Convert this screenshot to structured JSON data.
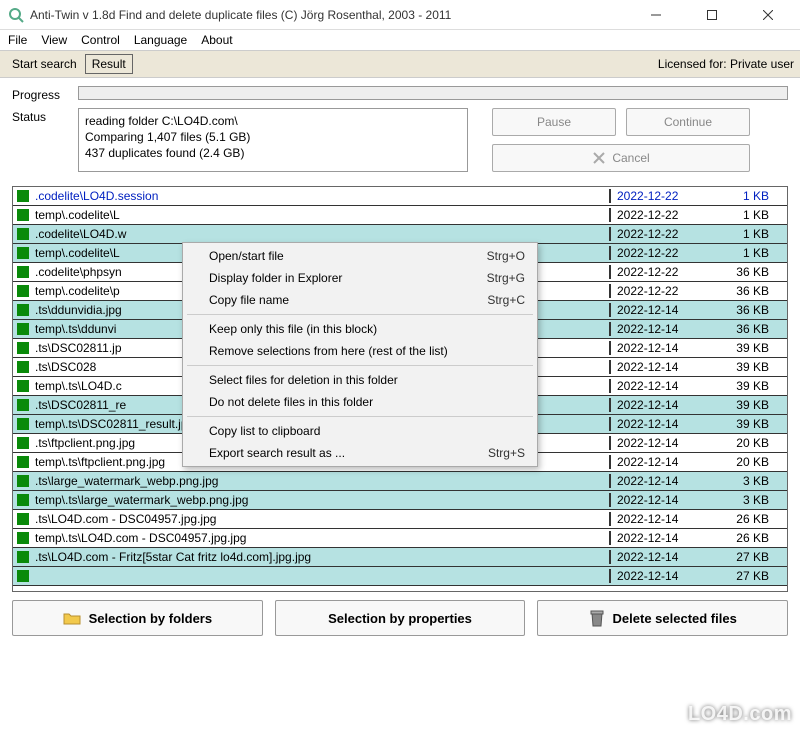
{
  "window": {
    "title": "Anti-Twin   v 1.8d    Find and delete duplicate files    (C) Jörg Rosenthal, 2003 - 2011"
  },
  "menu": {
    "file": "File",
    "view": "View",
    "control": "Control",
    "language": "Language",
    "about": "About"
  },
  "toolbar": {
    "start_search": "Start search",
    "result": "Result",
    "licensed": "Licensed for: Private user"
  },
  "labels": {
    "progress": "Progress",
    "status": "Status"
  },
  "status_text": "reading folder C:\\LO4D.com\\\nComparing 1,407 files (5.1 GB)\n437 duplicates found (2.4 GB)",
  "buttons": {
    "pause": "Pause",
    "continue": "Continue",
    "cancel": "Cancel",
    "sel_folders": "Selection by folders",
    "sel_props": "Selection by properties",
    "delete": "Delete selected files"
  },
  "context_menu": [
    {
      "label": "Open/start file",
      "accel": "Strg+O"
    },
    {
      "label": "Display folder in Explorer",
      "accel": "Strg+G"
    },
    {
      "label": "Copy file name",
      "accel": "Strg+C"
    },
    {
      "sep": true
    },
    {
      "label": "Keep only this file (in this block)",
      "accel": ""
    },
    {
      "label": "Remove selections from here (rest of the list)",
      "accel": ""
    },
    {
      "sep": true
    },
    {
      "label": "Select files for deletion in this folder",
      "accel": ""
    },
    {
      "label": "Do not delete files in this folder",
      "accel": ""
    },
    {
      "sep": true
    },
    {
      "label": "Copy list to clipboard",
      "accel": ""
    },
    {
      "label": "Export search result as ...",
      "accel": "Strg+S"
    }
  ],
  "files": [
    {
      "name": ".codelite\\LO4D.session",
      "date": "2022-12-22",
      "size": "1 KB",
      "hl": false,
      "first": true
    },
    {
      "name": "temp\\.codelite\\L",
      "date": "2022-12-22",
      "size": "1 KB",
      "hl": false
    },
    {
      "name": ".codelite\\LO4D.w",
      "date": "2022-12-22",
      "size": "1 KB",
      "hl": true
    },
    {
      "name": "temp\\.codelite\\L",
      "date": "2022-12-22",
      "size": "1 KB",
      "hl": true
    },
    {
      "name": ".codelite\\phpsyn",
      "date": "2022-12-22",
      "size": "36 KB",
      "hl": false
    },
    {
      "name": "temp\\.codelite\\p",
      "date": "2022-12-22",
      "size": "36 KB",
      "hl": false
    },
    {
      "name": ".ts\\ddunvidia.jpg",
      "date": "2022-12-14",
      "size": "36 KB",
      "hl": true
    },
    {
      "name": "temp\\.ts\\ddunvi",
      "date": "2022-12-14",
      "size": "36 KB",
      "hl": true
    },
    {
      "name": ".ts\\DSC02811.jp",
      "date": "2022-12-14",
      "size": "39 KB",
      "hl": false
    },
    {
      "name": ".ts\\DSC028",
      "date": "2022-12-14",
      "size": "39 KB",
      "hl": false
    },
    {
      "name": "temp\\.ts\\LO4D.c",
      "date": "2022-12-14",
      "size": "39 KB",
      "hl": false
    },
    {
      "name": ".ts\\DSC02811_re",
      "date": "2022-12-14",
      "size": "39 KB",
      "hl": true
    },
    {
      "name": "temp\\.ts\\DSC02811_result.jpg.jpg",
      "date": "2022-12-14",
      "size": "39 KB",
      "hl": true
    },
    {
      "name": ".ts\\ftpclient.png.jpg",
      "date": "2022-12-14",
      "size": "20 KB",
      "hl": false
    },
    {
      "name": "temp\\.ts\\ftpclient.png.jpg",
      "date": "2022-12-14",
      "size": "20 KB",
      "hl": false
    },
    {
      "name": ".ts\\large_watermark_webp.png.jpg",
      "date": "2022-12-14",
      "size": "3 KB",
      "hl": true
    },
    {
      "name": "temp\\.ts\\large_watermark_webp.png.jpg",
      "date": "2022-12-14",
      "size": "3 KB",
      "hl": true
    },
    {
      "name": ".ts\\LO4D.com - DSC04957.jpg.jpg",
      "date": "2022-12-14",
      "size": "26 KB",
      "hl": false
    },
    {
      "name": "temp\\.ts\\LO4D.com - DSC04957.jpg.jpg",
      "date": "2022-12-14",
      "size": "26 KB",
      "hl": false
    },
    {
      "name": ".ts\\LO4D.com - Fritz[5star Cat fritz lo4d.com].jpg.jpg",
      "date": "2022-12-14",
      "size": "27 KB",
      "hl": true
    },
    {
      "name": "",
      "date": "2022-12-14",
      "size": "27 KB",
      "hl": true
    }
  ],
  "watermark": "LO4D.com"
}
